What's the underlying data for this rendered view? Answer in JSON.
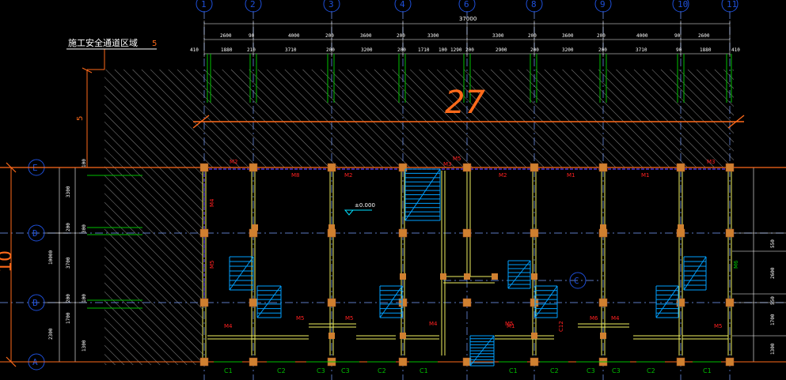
{
  "title_label": "施工安全通道区域",
  "big_dim_label": "27",
  "side_dim_label": "10",
  "offset_5_top": "5",
  "offset_5_left": "5",
  "elevation_label": "±0.000",
  "grid_x": [
    "1",
    "2",
    "3",
    "4",
    "6",
    "8",
    "9",
    "10",
    "11"
  ],
  "grid_y": [
    "E",
    "D",
    "B",
    "A"
  ],
  "grid_c_label": "C",
  "overall_dim": "37000",
  "dims_row1": [
    "2600",
    "90",
    "4000",
    "200",
    "3600",
    "200",
    "3300",
    "3300",
    "200",
    "3600",
    "200",
    "4000",
    "90",
    "2600"
  ],
  "dims_row2": [
    "410",
    "1880",
    "210",
    "3710",
    "200",
    "3200",
    "200",
    "1710",
    "100",
    "1290",
    "200",
    "2900",
    "200",
    "3200",
    "200",
    "3710",
    "90",
    "1880",
    "410"
  ],
  "left_dims": [
    "3300",
    "200",
    "3700",
    "200",
    "1700",
    "2300",
    "1300",
    "300",
    "10000",
    "100",
    "100"
  ],
  "right_dims": [
    "550",
    "2600",
    "550",
    "1700",
    "1300"
  ],
  "door_labels": [
    "M2",
    "M8",
    "M2",
    "M5",
    "M2",
    "M1",
    "M1",
    "M3",
    "M4",
    "M5",
    "M6",
    "M4",
    "M5",
    "M5",
    "M4",
    "M5",
    "M6",
    "M4",
    "M5",
    "M3",
    "M1"
  ],
  "window_labels": [
    "C1",
    "C2",
    "C3",
    "C3",
    "C2",
    "C1",
    "C1",
    "C2",
    "C3",
    "C3",
    "C2",
    "C1"
  ],
  "misc_label": "C12",
  "colors": {
    "background": "#000000",
    "grid_bubble": "#1e4fd8",
    "dimension": "#ffffff",
    "wall": "#f0f060",
    "column": "#d08030",
    "hatch": "#808080",
    "stair": "#00a0ff",
    "orange": "#ff6a1a",
    "green": "#00c000",
    "red_label": "#ff2020",
    "axis_line": "#7aa0ff",
    "stair_text": "#00e0ff"
  }
}
